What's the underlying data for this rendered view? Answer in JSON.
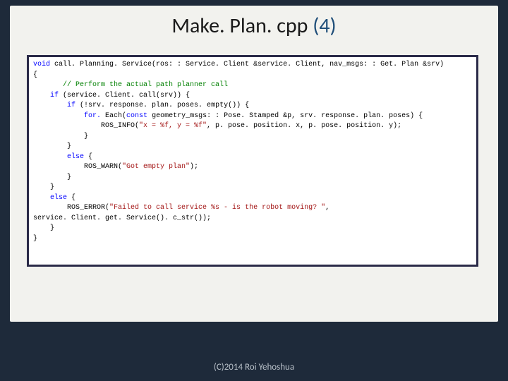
{
  "title_plain": "Make. Plan. cpp ",
  "title_accent": "(4)",
  "footer": "(C)2014 Roi Yehoshua",
  "code": {
    "l01a": "void",
    "l01b": " call. Planning. Service(ros: : Service. Client &service. Client, nav_msgs: : Get. Plan &srv)",
    "l02": "{",
    "l03pad": "       ",
    "l03cm": "// Perform the actual path planner call",
    "l04a": "    ",
    "l04kw": "if",
    "l04b": " (service. Client. call(srv)) {",
    "l05a": "        ",
    "l05kw": "if",
    "l05b": " (!srv. response. plan. poses. empty()) {",
    "l06a": "            ",
    "l06kw1": "for.",
    "l06b": " Each(",
    "l06kw2": "const",
    "l06c": " geometry_msgs: : Pose. Stamped &p, srv. response. plan. poses) {",
    "l07a": "                ROS_INFO(",
    "l07st": "\"x = %f, y = %f\"",
    "l07b": ", p. pose. position. x, p. pose. position. y);",
    "l08": "            }",
    "l09": "        }",
    "l10a": "        ",
    "l10kw": "else",
    "l10b": " {",
    "l11a": "            ROS_WARN(",
    "l11st": "\"Got empty plan\"",
    "l11b": ");",
    "l12": "        }",
    "l13": "    }",
    "l14a": "    ",
    "l14kw": "else",
    "l14b": " {",
    "l15a": "        ROS_ERROR(",
    "l15st": "\"Failed to call service %s - is the robot moving? \"",
    "l15b": ",",
    "l16": "service. Client. get. Service(). c_str());",
    "l17": "    }",
    "l18": "}"
  }
}
